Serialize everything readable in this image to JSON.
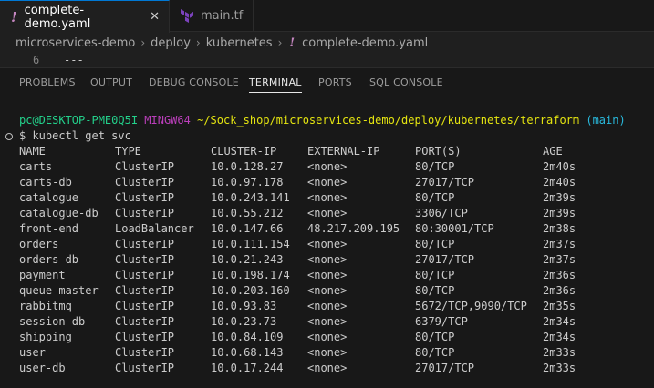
{
  "tabs": [
    {
      "label": "complete-demo.yaml",
      "active": true,
      "icon": "yaml-file-icon"
    },
    {
      "label": "main.tf",
      "active": false,
      "icon": "terraform-file-icon"
    }
  ],
  "close_glyph": "✕",
  "breadcrumb": [
    "microservices-demo",
    "deploy",
    "kubernetes",
    "complete-demo.yaml"
  ],
  "code": {
    "line_number": "6",
    "text": "---"
  },
  "panel_tabs": [
    {
      "label": "PROBLEMS",
      "active": false
    },
    {
      "label": "OUTPUT",
      "active": false
    },
    {
      "label": "DEBUG CONSOLE",
      "active": false
    },
    {
      "label": "TERMINAL",
      "active": true
    },
    {
      "label": "PORTS",
      "active": false
    },
    {
      "label": "SQL CONSOLE",
      "active": false
    }
  ],
  "terminal": {
    "prompt_user": "pc@DESKTOP-PME0Q5I",
    "prompt_host": "MINGW64",
    "prompt_path": "~/Sock_shop/microservices-demo/deploy/kubernetes/terraform",
    "prompt_branch": "(main)",
    "command": "$ kubectl get svc",
    "headers": [
      "NAME",
      "TYPE",
      "CLUSTER-IP",
      "EXTERNAL-IP",
      "PORT(S)",
      "AGE"
    ],
    "rows": [
      [
        "carts",
        "ClusterIP",
        "10.0.128.27",
        "<none>",
        "80/TCP",
        "2m40s"
      ],
      [
        "carts-db",
        "ClusterIP",
        "10.0.97.178",
        "<none>",
        "27017/TCP",
        "2m40s"
      ],
      [
        "catalogue",
        "ClusterIP",
        "10.0.243.141",
        "<none>",
        "80/TCP",
        "2m39s"
      ],
      [
        "catalogue-db",
        "ClusterIP",
        "10.0.55.212",
        "<none>",
        "3306/TCP",
        "2m39s"
      ],
      [
        "front-end",
        "LoadBalancer",
        "10.0.147.66",
        "48.217.209.195",
        "80:30001/TCP",
        "2m38s"
      ],
      [
        "orders",
        "ClusterIP",
        "10.0.111.154",
        "<none>",
        "80/TCP",
        "2m37s"
      ],
      [
        "orders-db",
        "ClusterIP",
        "10.0.21.243",
        "<none>",
        "27017/TCP",
        "2m37s"
      ],
      [
        "payment",
        "ClusterIP",
        "10.0.198.174",
        "<none>",
        "80/TCP",
        "2m36s"
      ],
      [
        "queue-master",
        "ClusterIP",
        "10.0.203.160",
        "<none>",
        "80/TCP",
        "2m36s"
      ],
      [
        "rabbitmq",
        "ClusterIP",
        "10.0.93.83",
        "<none>",
        "5672/TCP,9090/TCP",
        "2m35s"
      ],
      [
        "session-db",
        "ClusterIP",
        "10.0.23.73",
        "<none>",
        "6379/TCP",
        "2m34s"
      ],
      [
        "shipping",
        "ClusterIP",
        "10.0.84.109",
        "<none>",
        "80/TCP",
        "2m34s"
      ],
      [
        "user",
        "ClusterIP",
        "10.0.68.143",
        "<none>",
        "80/TCP",
        "2m33s"
      ],
      [
        "user-db",
        "ClusterIP",
        "10.0.17.244",
        "<none>",
        "27017/TCP",
        "2m33s"
      ]
    ]
  },
  "colors": {
    "accent": "#0078d4",
    "prompt_user": "#23d18b",
    "prompt_host": "#bc3fbc",
    "prompt_path": "#e5e510",
    "prompt_branch": "#29b8db"
  }
}
